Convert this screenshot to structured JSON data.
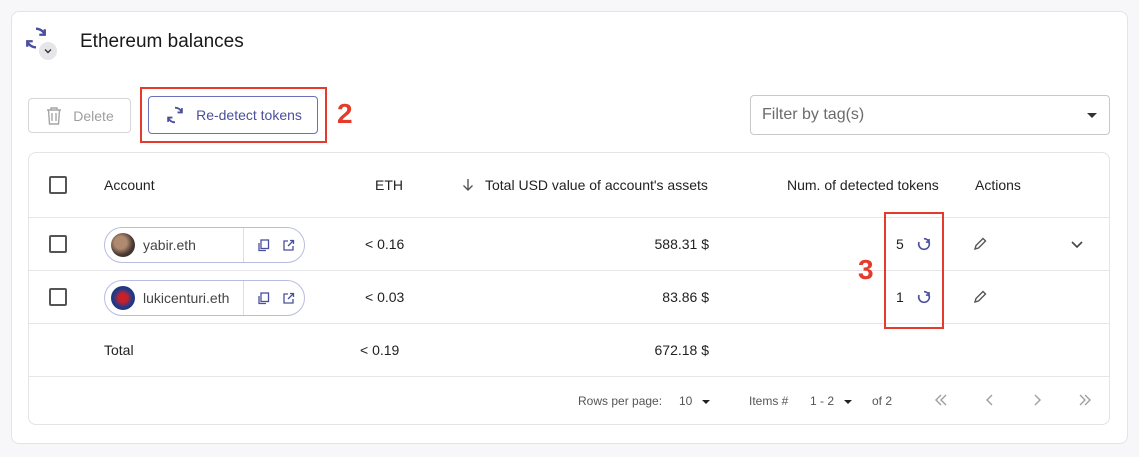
{
  "header": {
    "title": "Ethereum balances"
  },
  "toolbar": {
    "delete_label": "Delete",
    "redetect_label": "Re-detect tokens",
    "filter_placeholder": "Filter by tag(s)"
  },
  "annotations": {
    "a2": "2",
    "a3": "3"
  },
  "table": {
    "columns": {
      "account": "Account",
      "eth": "ETH",
      "usd": "Total USD value of account's assets",
      "tokens": "Num. of detected tokens",
      "actions": "Actions"
    },
    "rows": [
      {
        "account": "yabir.eth",
        "eth": "< 0.16",
        "usd": "588.31 $",
        "tokens": "5"
      },
      {
        "account": "lukicenturi.eth",
        "eth": "< 0.03",
        "usd": "83.86 $",
        "tokens": "1"
      }
    ],
    "total": {
      "label": "Total",
      "eth": "< 0.19",
      "usd": "672.18 $"
    }
  },
  "pagination": {
    "rows_per_page_label": "Rows per page:",
    "rows_per_page": "10",
    "items_label": "Items #",
    "items_range": "1 - 2",
    "of_label": "of 2"
  },
  "colors": {
    "accent": "#4a4f9d",
    "annotation": "#e53b2c"
  }
}
